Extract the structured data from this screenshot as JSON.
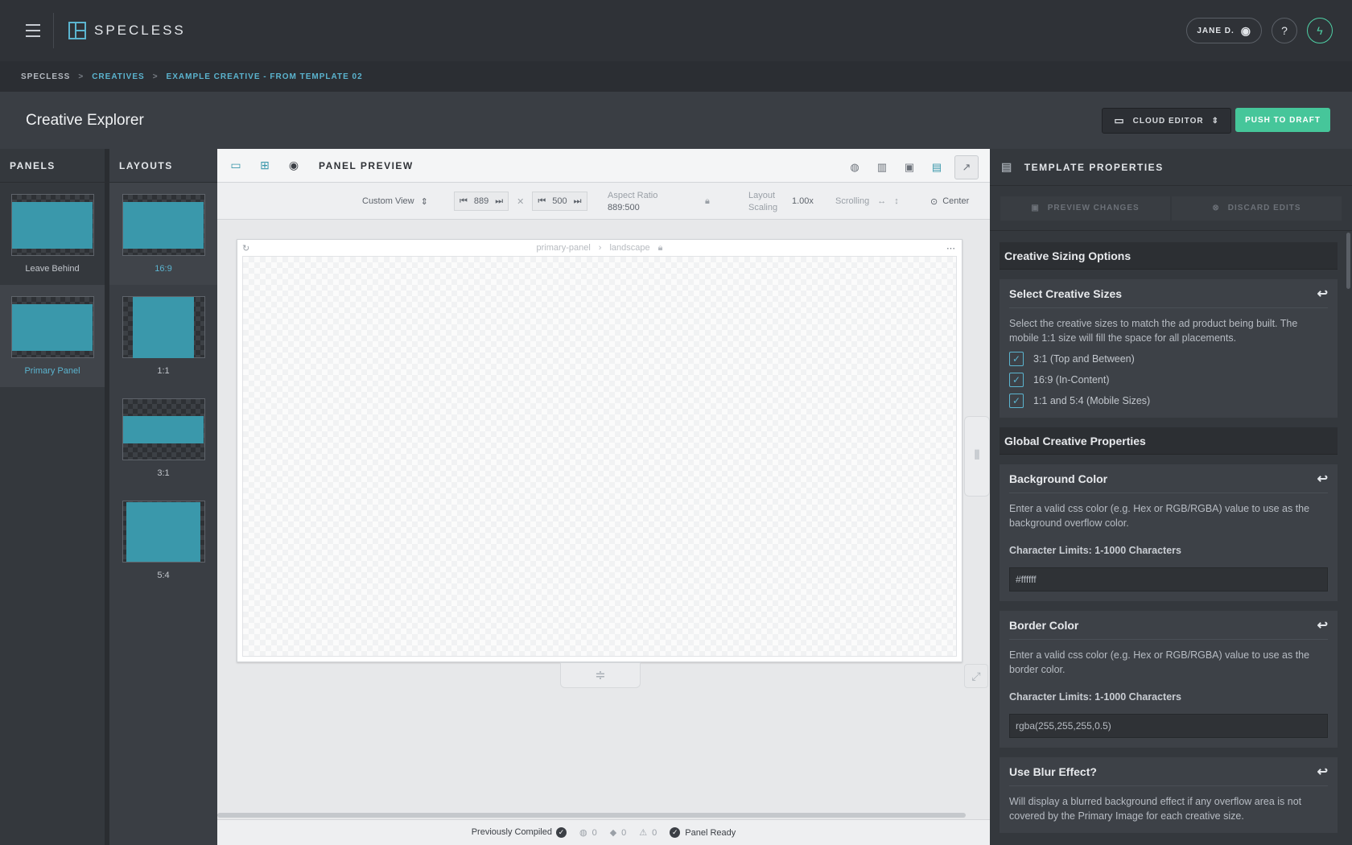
{
  "app": {
    "logo_text": "SPECLESS"
  },
  "header": {
    "user_label": "JANE D.",
    "icons": {
      "menu": "hamburger-icon",
      "user": "user-circle-icon",
      "help": "help-icon",
      "power": "lightning-icon"
    }
  },
  "breadcrumb": {
    "items": [
      "SPECLESS",
      "CREATIVES",
      "EXAMPLE CREATIVE - FROM TEMPLATE 02"
    ],
    "separator": ">"
  },
  "title_bar": {
    "title": "Creative Explorer",
    "editor_label": "CLOUD EDITOR",
    "push_label": "PUSH TO DRAFT"
  },
  "panels": {
    "header": "PANELS",
    "items": [
      {
        "label": "Leave Behind",
        "selected": false
      },
      {
        "label": "Primary Panel",
        "selected": true
      }
    ]
  },
  "layouts": {
    "header": "LAYOUTS",
    "items": [
      {
        "label": "16:9",
        "selected": true
      },
      {
        "label": "1:1",
        "selected": false
      },
      {
        "label": "3:1",
        "selected": false
      },
      {
        "label": "5:4",
        "selected": false
      }
    ]
  },
  "preview": {
    "title": "PANEL PREVIEW",
    "view_select": "Custom View",
    "width": "889",
    "height": "500",
    "aspect_label": "Aspect Ratio",
    "aspect_value": "889:500",
    "layout_scaling_label_1": "Layout",
    "layout_scaling_label_2": "Scaling",
    "scaling_value": "1.00x",
    "scrolling_label": "Scrolling",
    "center_label": "Center",
    "canvas_path_1": "primary-panel",
    "canvas_path_2": "landscape"
  },
  "status": {
    "compiled": "Previously Compiled",
    "messages": "0",
    "diamonds": "0",
    "warnings": "0",
    "ready": "Panel Ready"
  },
  "properties": {
    "header": "TEMPLATE PROPERTIES",
    "preview_changes": "PREVIEW CHANGES",
    "discard_edits": "DISCARD EDITS",
    "sizing_section": "Creative Sizing Options",
    "select_sizes_title": "Select Creative Sizes",
    "select_sizes_desc": "Select the creative sizes to match the ad product being built. The mobile 1:1 size will fill the space for all placements.",
    "sizes": [
      "3:1 (Top and Between)",
      "16:9 (In-Content)",
      "1:1 and 5:4 (Mobile Sizes)"
    ],
    "global_section": "Global Creative Properties",
    "bg_title": "Background Color",
    "bg_desc": "Enter a valid css color (e.g. Hex or RGB/RGBA) value to use as the background overflow color.",
    "bg_limits": "Character Limits: 1-1000 Characters",
    "bg_value": "#ffffff",
    "border_title": "Border Color",
    "border_desc": "Enter a valid css color (e.g. Hex or RGB/RGBA) value to use as the border color.",
    "border_limits": "Character Limits: 1-1000 Characters",
    "border_value": "rgba(255,255,255,0.5)",
    "blur_title": "Use Blur Effect?",
    "blur_desc": "Will display a blurred background effect if any overflow area is not covered by the Primary Image for each creative size."
  },
  "colors": {
    "accent": "#5bb4cf",
    "push": "#46c69a",
    "thumb_fill": "#3a98ab"
  }
}
